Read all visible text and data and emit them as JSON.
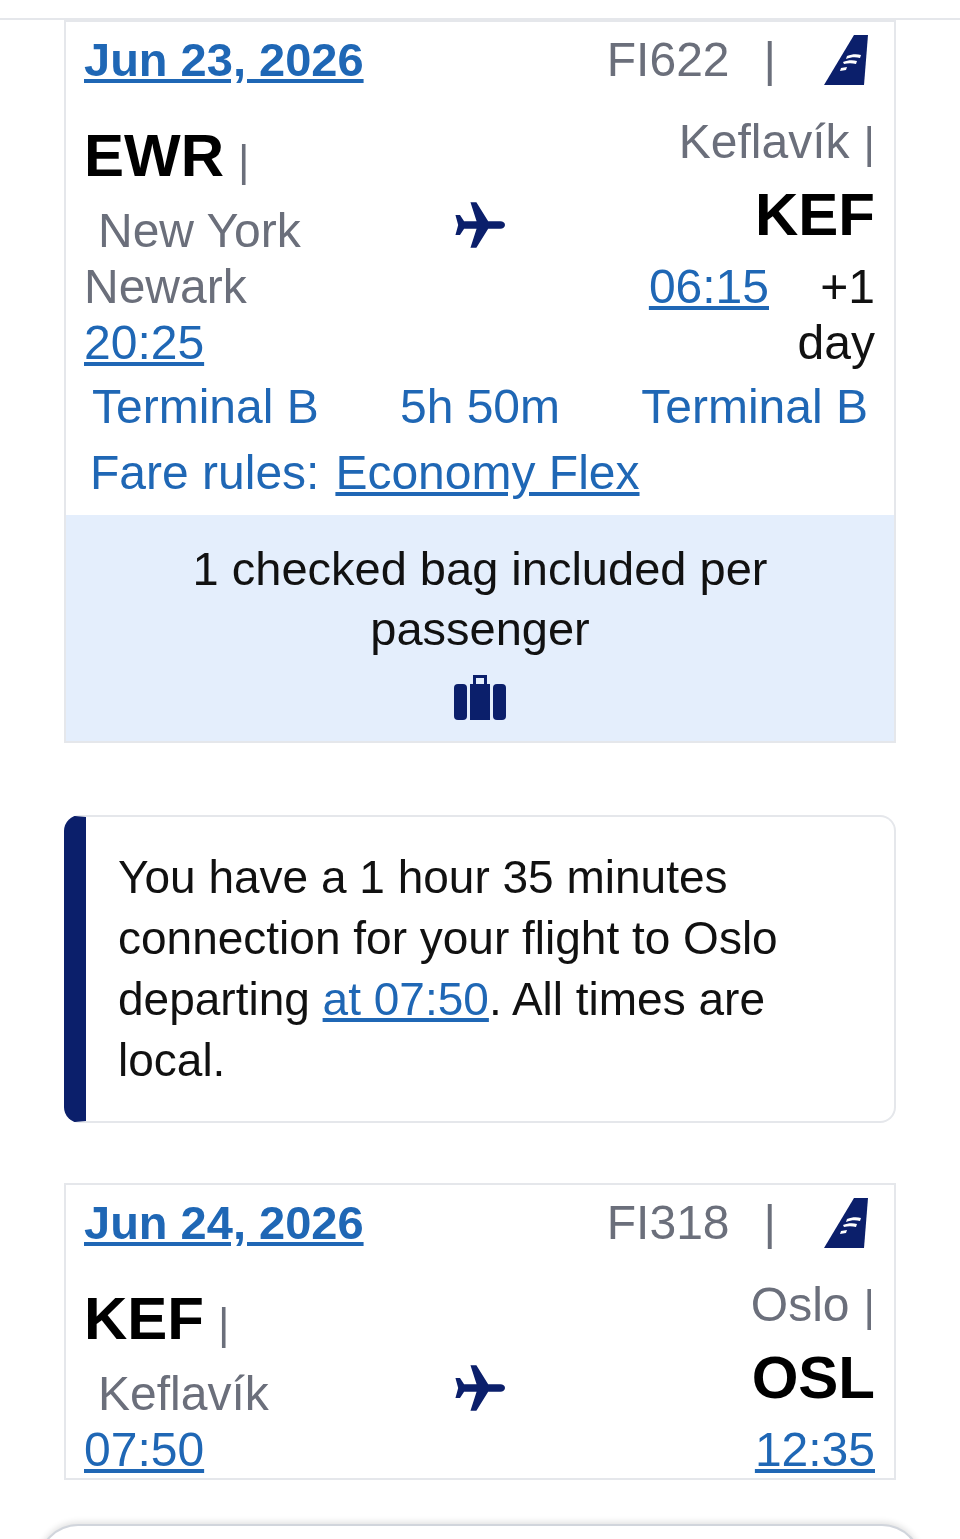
{
  "flights": [
    {
      "date": "Jun 23, 2026",
      "flight_number": "FI622",
      "separator": "|",
      "origin": {
        "code": "EWR",
        "separator": "|",
        "city": "New York Newark",
        "time": "20:25"
      },
      "destination": {
        "city": "Keflavík",
        "separator": "|",
        "code": "KEF",
        "time": "06:15",
        "day_offset": "+1 day"
      },
      "departure_terminal": "Terminal B",
      "duration": "5h 50m",
      "arrival_terminal": "Terminal B",
      "fare_rules_label": "Fare rules:",
      "fare_name": "Economy Flex",
      "baggage": "1 checked bag included per passenger"
    },
    {
      "date": "Jun 24, 2026",
      "flight_number": "FI318",
      "separator": "|",
      "origin": {
        "code": "KEF",
        "separator": "|",
        "city": "Keflavík",
        "time": "07:50"
      },
      "destination": {
        "city": "Oslo",
        "separator": "|",
        "code": "OSL",
        "time": "12:35"
      }
    }
  ],
  "notice": {
    "before": "You have a 1 hour 35 minutes connection for your flight to Oslo departing ",
    "link": "at 07:50",
    "after": ". All times are local."
  }
}
